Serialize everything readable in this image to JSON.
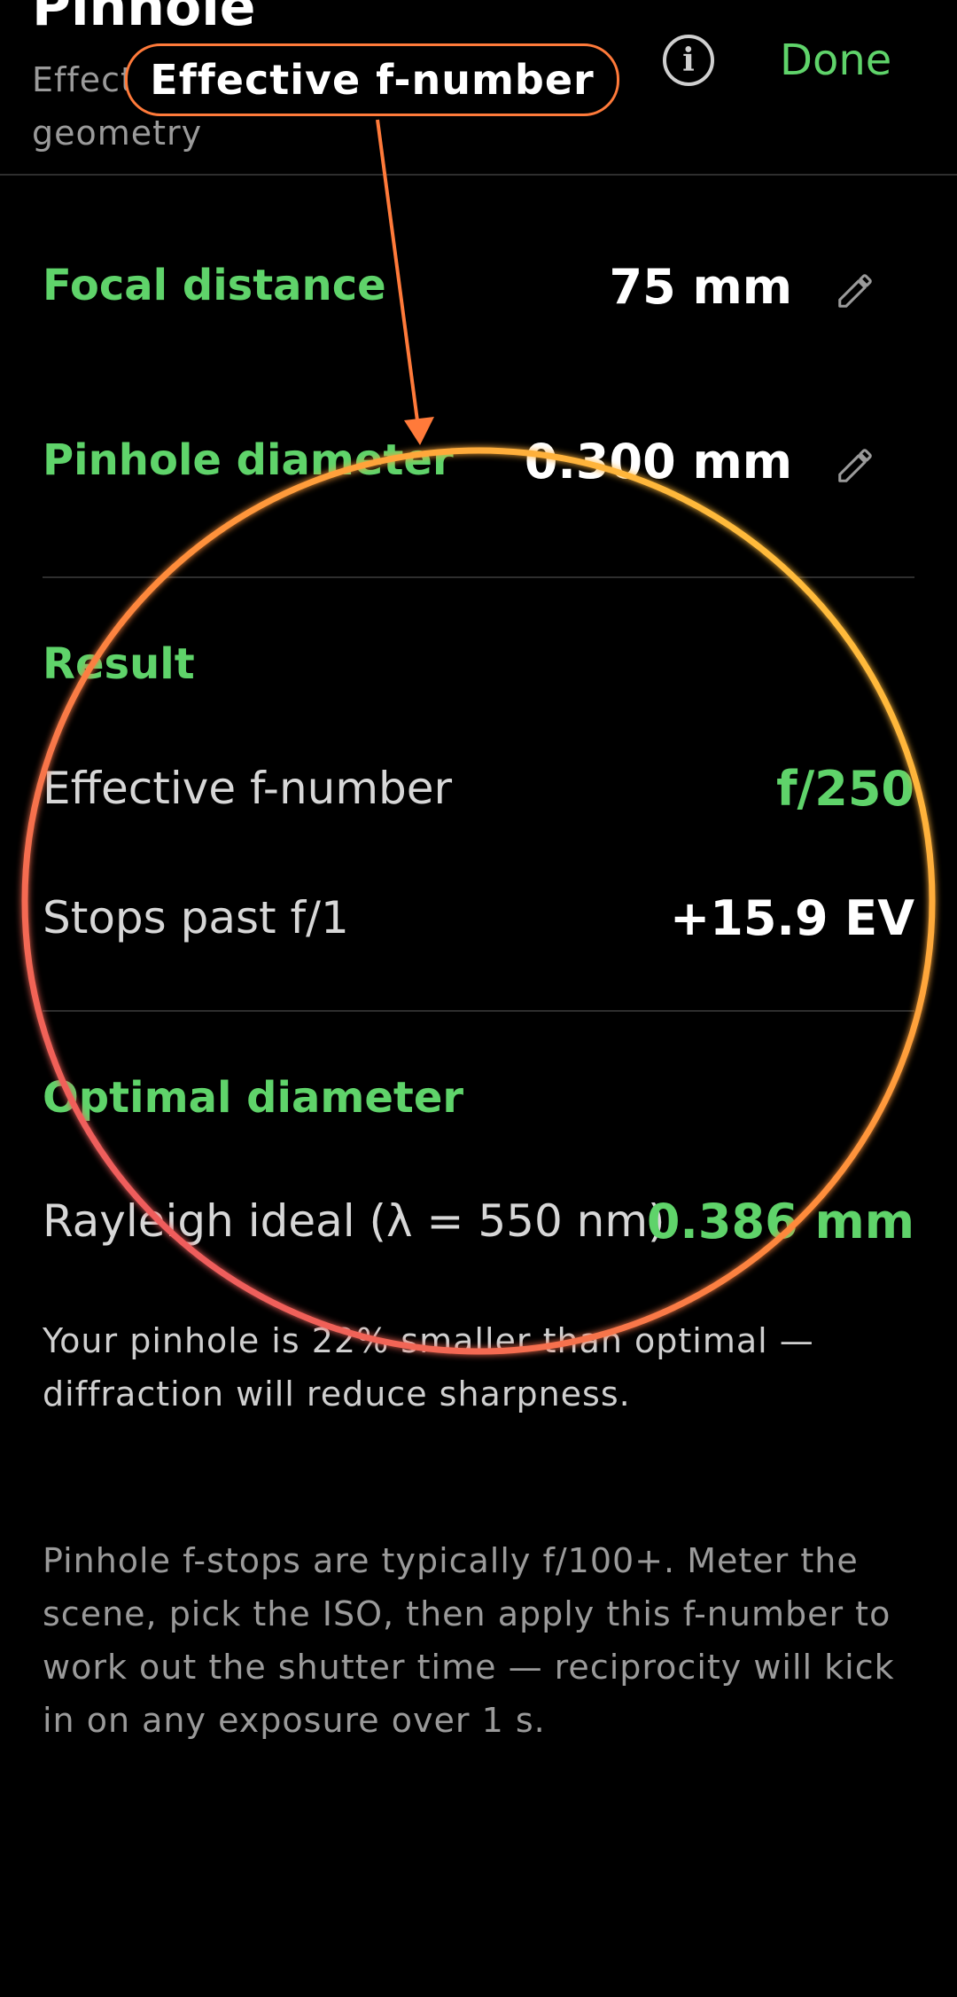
{
  "header": {
    "title": "Pinhole",
    "subtitle": "Effective f-number from pinhole geometry",
    "done_label": "Done",
    "info_icon": "info-icon"
  },
  "inputs": {
    "focal_distance": {
      "label": "Focal distance",
      "value": "75 mm",
      "edit_icon": "pencil-icon"
    },
    "pinhole_diameter": {
      "label": "Pinhole diameter",
      "value": "0.300 mm",
      "edit_icon": "pencil-icon"
    }
  },
  "result": {
    "title": "Result",
    "effective_f_number": {
      "label": "Effective f-number",
      "value": "f/250"
    },
    "stops_past": {
      "label": "Stops past f/1",
      "value": "+15.9 EV"
    }
  },
  "optimal": {
    "title": "Optimal diameter",
    "rayleigh": {
      "label": "Rayleigh ideal (λ = 550 nm)",
      "value": "0.386 mm"
    },
    "warning": "Your pinhole is 22% smaller than optimal — diffraction will reduce sharpness."
  },
  "help_text": "Pinhole f-stops are typically f/100+. Meter the scene, pick the ISO, then apply this f-number to work out the shutter time — reciprocity will kick in on any exposure over 1 s.",
  "annotation": {
    "label": "Effective f-number"
  },
  "colors": {
    "accent": "#5fd36a",
    "background": "#000000",
    "annotation_ring_start": "#ffcf3a",
    "annotation_ring_end": "#e84a6a",
    "annotation_arrow": "#ff7a3a"
  }
}
